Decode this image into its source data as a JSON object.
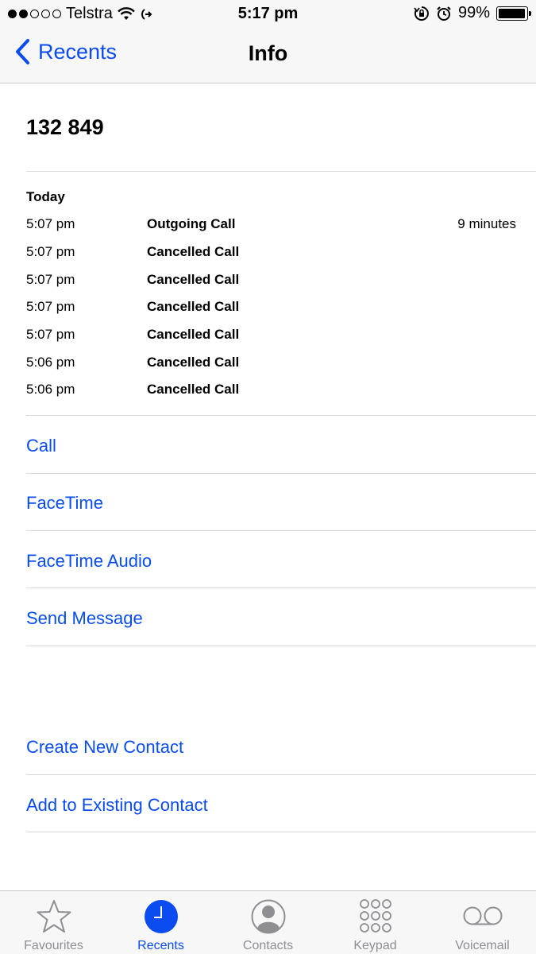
{
  "status_bar": {
    "carrier": "Telstra",
    "time": "5:17 pm",
    "battery": "99%"
  },
  "nav": {
    "back_label": "Recents",
    "title": "Info"
  },
  "contact": {
    "number": "132 849"
  },
  "history": {
    "header": "Today",
    "calls": [
      {
        "time": "5:07 pm",
        "type": "Outgoing Call",
        "duration": "9 minutes"
      },
      {
        "time": "5:07 pm",
        "type": "Cancelled Call",
        "duration": ""
      },
      {
        "time": "5:07 pm",
        "type": "Cancelled Call",
        "duration": ""
      },
      {
        "time": "5:07 pm",
        "type": "Cancelled Call",
        "duration": ""
      },
      {
        "time": "5:07 pm",
        "type": "Cancelled Call",
        "duration": ""
      },
      {
        "time": "5:06 pm",
        "type": "Cancelled Call",
        "duration": ""
      },
      {
        "time": "5:06 pm",
        "type": "Cancelled Call",
        "duration": ""
      }
    ]
  },
  "actions": {
    "call": "Call",
    "facetime": "FaceTime",
    "facetime_audio": "FaceTime Audio",
    "send_message": "Send Message",
    "create_contact": "Create New Contact",
    "add_existing": "Add to Existing Contact"
  },
  "tabs": [
    {
      "label": "Favourites",
      "icon": "star-icon"
    },
    {
      "label": "Recents",
      "icon": "clock-icon",
      "active": true
    },
    {
      "label": "Contacts",
      "icon": "person-icon"
    },
    {
      "label": "Keypad",
      "icon": "keypad-icon"
    },
    {
      "label": "Voicemail",
      "icon": "voicemail-icon"
    }
  ],
  "colors": {
    "accent": "#0a4cf0",
    "inactive": "#8e8e93",
    "bar_bg": "#f7f7f8"
  }
}
